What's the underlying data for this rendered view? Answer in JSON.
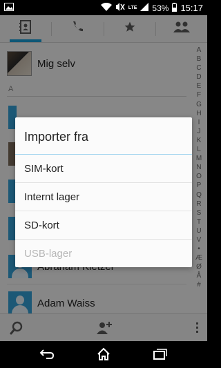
{
  "status_bar": {
    "network_type": "LTE",
    "battery_percent": "53%",
    "time": "15:17"
  },
  "tabs": [
    {
      "name": "contacts",
      "icon": "contact-book-icon",
      "active": true
    },
    {
      "name": "phone",
      "icon": "phone-icon",
      "active": false
    },
    {
      "name": "favorites",
      "icon": "star-icon",
      "active": false
    },
    {
      "name": "groups",
      "icon": "groups-icon",
      "active": false
    }
  ],
  "me_row": {
    "name": "Mig selv"
  },
  "section_letter": "A",
  "contacts": [
    {
      "name": "Abraham Kletzel"
    },
    {
      "name": "Adam Waiss"
    }
  ],
  "index_letters": [
    "A",
    "B",
    "C",
    "D",
    "E",
    "F",
    "G",
    "H",
    "I",
    "J",
    "K",
    "L",
    "M",
    "N",
    "O",
    "P",
    "Q",
    "R",
    "S",
    "T",
    "U",
    "V",
    "•",
    "Æ",
    "Ø",
    "Å",
    "#"
  ],
  "dialog": {
    "title": "Importer fra",
    "options": [
      {
        "label": "SIM-kort",
        "enabled": true
      },
      {
        "label": "Internt lager",
        "enabled": true
      },
      {
        "label": "SD-kort",
        "enabled": true
      },
      {
        "label": "USB-lager",
        "enabled": false
      }
    ]
  },
  "colors": {
    "accent": "#1a9fd8",
    "avatar_default": "#34a0d8",
    "dialog_divider": "#9fd3ee"
  }
}
